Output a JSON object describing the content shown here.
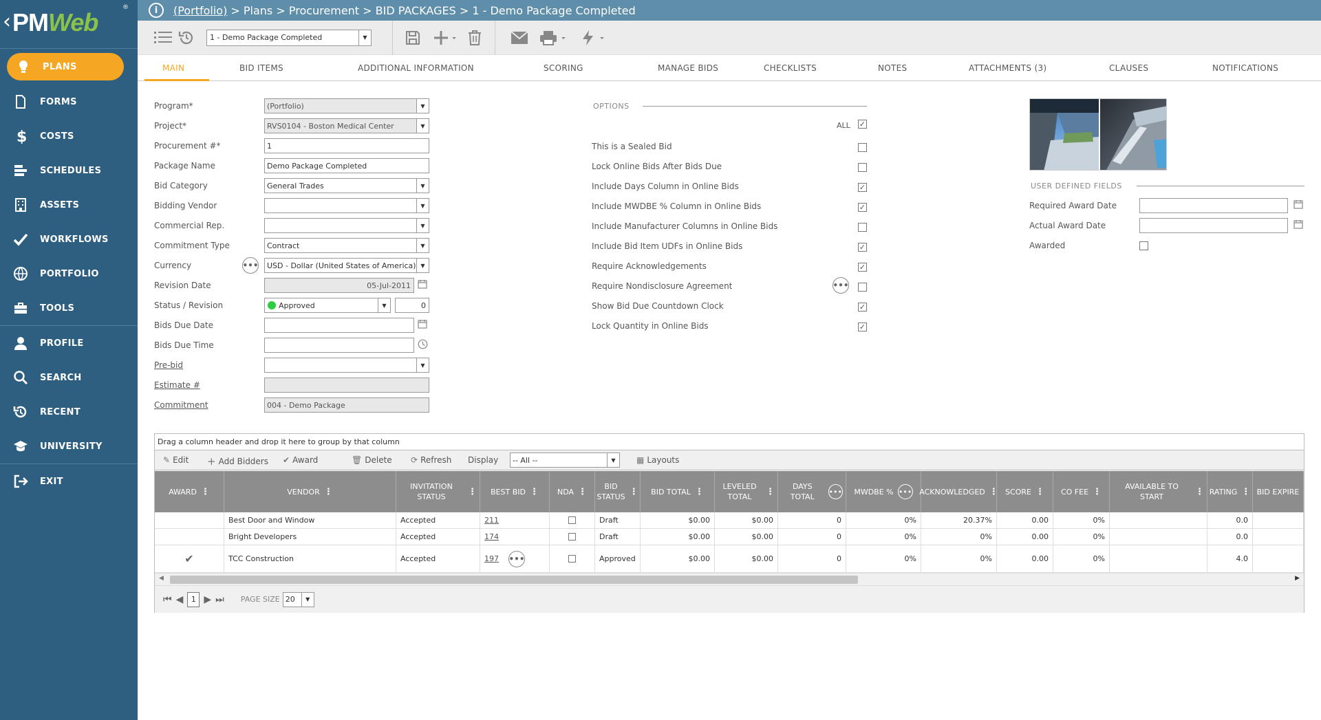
{
  "app": {
    "logo_text_1": "PM",
    "logo_text_2": "Web",
    "logo_mark": "®"
  },
  "sidebar": {
    "items": [
      {
        "label": "PLANS",
        "icon": "lightbulb-icon",
        "active": true
      },
      {
        "label": "FORMS",
        "icon": "document-icon"
      },
      {
        "label": "COSTS",
        "icon": "dollar-icon"
      },
      {
        "label": "SCHEDULES",
        "icon": "schedule-icon"
      },
      {
        "label": "ASSETS",
        "icon": "building-icon"
      },
      {
        "label": "WORKFLOWS",
        "icon": "checkmark-icon"
      },
      {
        "label": "PORTFOLIO",
        "icon": "globe-icon"
      },
      {
        "label": "TOOLS",
        "icon": "toolbox-icon"
      }
    ],
    "items2": [
      {
        "label": "PROFILE",
        "icon": "person-icon"
      },
      {
        "label": "SEARCH",
        "icon": "search-icon"
      },
      {
        "label": "RECENT",
        "icon": "history-icon"
      },
      {
        "label": "UNIVERSITY",
        "icon": "graduation-cap-icon"
      }
    ],
    "items3": [
      {
        "label": "EXIT",
        "icon": "exit-icon"
      }
    ]
  },
  "breadcrumb": {
    "portfolio": "(Portfolio)",
    "rest": " > Plans > Procurement > BID PACKAGES > 1 - Demo Package Completed"
  },
  "toolbar": {
    "record_select": "1 -  Demo Package Completed"
  },
  "tabs": [
    {
      "label": "MAIN",
      "active": true
    },
    {
      "label": "BID ITEMS"
    },
    {
      "label": "ADDITIONAL INFORMATION"
    },
    {
      "label": "SCORING"
    },
    {
      "label": "MANAGE BIDS"
    },
    {
      "label": "CHECKLISTS"
    },
    {
      "label": "NOTES"
    },
    {
      "label": "ATTACHMENTS (3)"
    },
    {
      "label": "CLAUSES"
    },
    {
      "label": "NOTIFICATIONS"
    }
  ],
  "form": {
    "program_label": "Program*",
    "program_value": "(Portfolio)",
    "project_label": "Project*",
    "project_value": "RVS0104 - Boston Medical Center",
    "procurement_label": "Procurement #*",
    "procurement_value": "1",
    "package_label": "Package Name",
    "package_value": "Demo Package Completed",
    "bid_category_label": "Bid Category",
    "bid_category_value": "General Trades",
    "bidding_vendor_label": "Bidding Vendor",
    "bidding_vendor_value": "",
    "commercial_rep_label": "Commercial Rep.",
    "commercial_rep_value": "",
    "commitment_type_label": "Commitment Type",
    "commitment_type_value": "Contract",
    "currency_label": "Currency",
    "currency_value": "USD - Dollar (United States of America)",
    "revision_date_label": "Revision Date",
    "revision_date_value": "05-Jul-2011",
    "status_label": "Status / Revision",
    "status_value": "Approved",
    "status_color": "#2ecc40",
    "revision_value": "0",
    "bids_due_date_label": "Bids Due Date",
    "bids_due_date_value": "",
    "bids_due_time_label": "Bids Due Time",
    "bids_due_time_value": "",
    "prebid_label": "Pre-bid",
    "prebid_value": "",
    "estimate_label": "Estimate #",
    "estimate_value": "",
    "commitment_label": "Commitment",
    "commitment_value": "004 - Demo Package"
  },
  "options": {
    "heading": "OPTIONS",
    "all_label": "ALL",
    "items": [
      {
        "label": "This is a Sealed Bid",
        "checked": false
      },
      {
        "label": "Lock Online Bids After Bids Due",
        "checked": false
      },
      {
        "label": "Include Days Column in Online Bids",
        "checked": true
      },
      {
        "label": "Include MWDBE % Column in Online Bids",
        "checked": true
      },
      {
        "label": "Include Manufacturer Columns in Online Bids",
        "checked": false
      },
      {
        "label": "Include Bid Item UDFs in Online Bids",
        "checked": true
      },
      {
        "label": "Require Acknowledgements",
        "checked": true
      },
      {
        "label": "Require Nondisclosure Agreement",
        "checked": false
      },
      {
        "label": "Show Bid Due Countdown Clock",
        "checked": true
      },
      {
        "label": "Lock Quantity in Online Bids",
        "checked": true
      }
    ]
  },
  "udf": {
    "heading": "USER DEFINED FIELDS",
    "required_award_label": "Required Award Date",
    "required_award_value": "",
    "actual_award_label": "Actual Award Date",
    "actual_award_value": "",
    "awarded_label": "Awarded"
  },
  "grid": {
    "drag_hint": "Drag a column header and drop it here to group by that column",
    "tools": {
      "edit": "Edit",
      "add_bidders": "Add Bidders",
      "award": "Award",
      "delete": "Delete",
      "refresh": "Refresh",
      "display": "Display",
      "display_value": "-- All --",
      "layouts": "Layouts"
    },
    "columns": [
      "AWARD",
      "VENDOR",
      "INVITATION STATUS",
      "BEST BID",
      "NDA",
      "BID STATUS",
      "BID TOTAL",
      "LEVELED TOTAL",
      "DAYS TOTAL",
      "MWDBE %",
      "ACKNOWLEDGED",
      "SCORE",
      "CO FEE",
      "AVAILABLE TO START",
      "RATING",
      "BID EXPIRE"
    ],
    "rows": [
      {
        "award": "",
        "vendor": "Best Door and Window",
        "invitation": "Accepted",
        "best_bid": "211",
        "bid_status": "Draft",
        "bid_total": "$0.00",
        "leveled": "$0.00",
        "days": "0",
        "mwdbe": "0%",
        "ack": "20.37%",
        "score": "0.00",
        "cofee": "0%",
        "avail": "",
        "rating": "0.0",
        "expire": ""
      },
      {
        "award": "",
        "vendor": "Bright Developers",
        "invitation": "Accepted",
        "best_bid": "174",
        "bid_status": "Draft",
        "bid_total": "$0.00",
        "leveled": "$0.00",
        "days": "0",
        "mwdbe": "0%",
        "ack": "0%",
        "score": "0.00",
        "cofee": "0%",
        "avail": "",
        "rating": "0.0",
        "expire": ""
      },
      {
        "award": "✔",
        "vendor": "TCC Construction",
        "invitation": "Accepted",
        "best_bid": "197",
        "bid_status": "Approved",
        "bid_total": "$0.00",
        "leveled": "$0.00",
        "days": "0",
        "mwdbe": "0%",
        "ack": "0%",
        "score": "0.00",
        "cofee": "0%",
        "avail": "",
        "rating": "4.0",
        "expire": ""
      }
    ],
    "pager": {
      "page": "1",
      "page_size_label": "PAGE SIZE",
      "page_size": "20"
    }
  }
}
